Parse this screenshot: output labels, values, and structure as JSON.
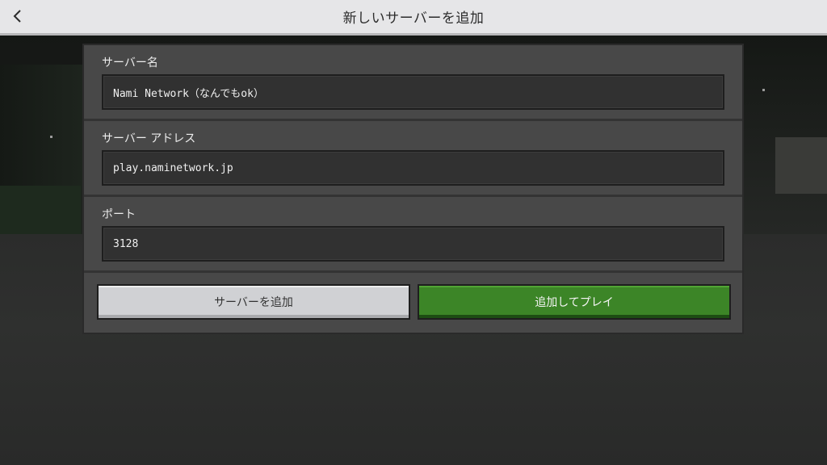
{
  "header": {
    "title": "新しいサーバーを追加",
    "back_icon": "chevron-left-icon"
  },
  "form": {
    "server_name": {
      "label": "サーバー名",
      "value": "Nami Network（なんでもok）"
    },
    "server_address": {
      "label": "サーバー アドレス",
      "value": "play.naminetwork.jp"
    },
    "port": {
      "label": "ポート",
      "value": "3128"
    }
  },
  "actions": {
    "add_server_label": "サーバーを追加",
    "add_and_play_label": "追加してプレイ"
  },
  "colors": {
    "topbar": "#e6e6e8",
    "panel": "#484848",
    "field": "#313131",
    "play_button": "#3c8527",
    "add_button": "#d0d1d4"
  }
}
